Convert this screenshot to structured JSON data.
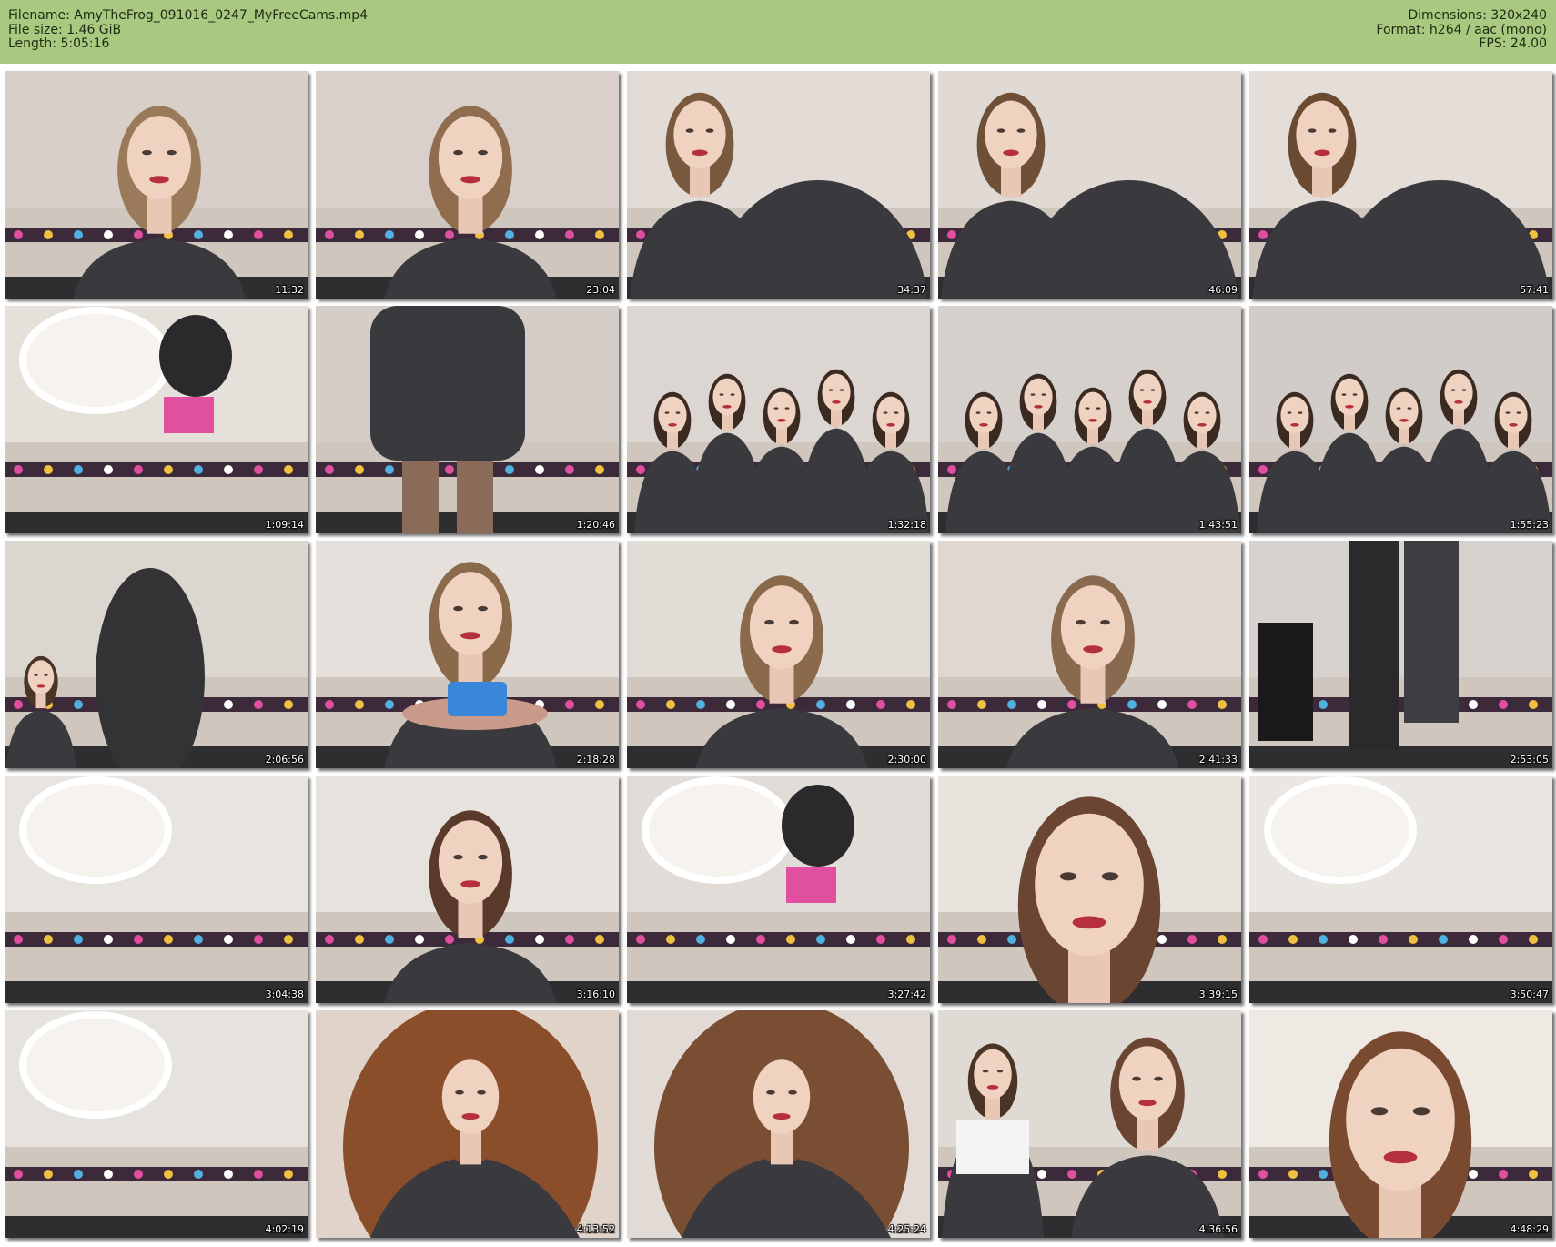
{
  "header": {
    "filename_label": "Filename: AmyTheFrog_091016_0247_MyFreeCams.mp4",
    "filesize_label": "File size: 1.46 GiB",
    "length_label": "Length: 5:05:16",
    "dimensions_label": "Dimensions: 320x240",
    "format_label": "Format: h264 / aac (mono)",
    "fps_label": "FPS: 24.00"
  },
  "colors": {
    "header_background": "#a8c97f",
    "page_background": "#ffffff"
  },
  "thumbnails": [
    {
      "time": "11:32",
      "scene": "closeup-smile",
      "bg": "#d8cfc9",
      "hair": "#9a7a5a"
    },
    {
      "time": "23:04",
      "scene": "closeup",
      "bg": "#d9d0cc",
      "hair": "#8f6d4e"
    },
    {
      "time": "34:37",
      "scene": "leaning",
      "bg": "#e3dcd6",
      "hair": "#7a5a3e"
    },
    {
      "time": "46:09",
      "scene": "leaning",
      "bg": "#e1dad4",
      "hair": "#6e5038"
    },
    {
      "time": "57:41",
      "scene": "leaning",
      "bg": "#e4ddd8",
      "hair": "#6b4a32"
    },
    {
      "time": "1:09:14",
      "scene": "empty-room",
      "bg": "#e6e0da",
      "hair": "#000000"
    },
    {
      "time": "1:20:46",
      "scene": "dress-closeup",
      "bg": "#d4cdc8",
      "hair": "#000000"
    },
    {
      "time": "1:32:18",
      "scene": "group",
      "bg": "#dcd6d2",
      "hair": "#3a2a22"
    },
    {
      "time": "1:43:51",
      "scene": "group",
      "bg": "#d6d0cc",
      "hair": "#3a2a22"
    },
    {
      "time": "1:55:23",
      "scene": "group",
      "bg": "#d2ccc8",
      "hair": "#3a2a22"
    },
    {
      "time": "2:06:56",
      "scene": "hug",
      "bg": "#dcd6d0",
      "hair": "#4a3426"
    },
    {
      "time": "2:18:28",
      "scene": "cake",
      "bg": "#e6e0dc",
      "hair": "#8a6a4a"
    },
    {
      "time": "2:30:00",
      "scene": "closeup",
      "bg": "#e2dcd6",
      "hair": "#8a6a4a"
    },
    {
      "time": "2:41:33",
      "scene": "closeup-smile",
      "bg": "#e0d8d0",
      "hair": "#8a6a4e"
    },
    {
      "time": "2:53:05",
      "scene": "standing",
      "bg": "#d8d2ce",
      "hair": "#3a2a22"
    },
    {
      "time": "3:04:38",
      "scene": "empty-wall",
      "bg": "#e8e4e0",
      "hair": "#000000"
    },
    {
      "time": "3:16:10",
      "scene": "closeup",
      "bg": "#e6e2de",
      "hair": "#5a3a2a"
    },
    {
      "time": "3:27:42",
      "scene": "empty-room",
      "bg": "#e2dcd8",
      "hair": "#000000"
    },
    {
      "time": "3:39:15",
      "scene": "face-zoom",
      "bg": "#e8e2dc",
      "hair": "#6a4632"
    },
    {
      "time": "3:50:47",
      "scene": "empty-wall",
      "bg": "#eae6e2",
      "hair": "#000000"
    },
    {
      "time": "4:02:19",
      "scene": "empty-wall",
      "bg": "#e6e2de",
      "hair": "#000000"
    },
    {
      "time": "4:13:52",
      "scene": "hair-hand",
      "bg": "#e0d4ca",
      "hair": "#8a4e2a"
    },
    {
      "time": "4:25:24",
      "scene": "hair-down",
      "bg": "#e2dad4",
      "hair": "#7a4e32"
    },
    {
      "time": "4:36:56",
      "scene": "two-people",
      "bg": "#e0dad4",
      "hair": "#6a4632"
    },
    {
      "time": "4:48:29",
      "scene": "face-zoom",
      "bg": "#efe9e4",
      "hair": "#7a4a30"
    }
  ]
}
